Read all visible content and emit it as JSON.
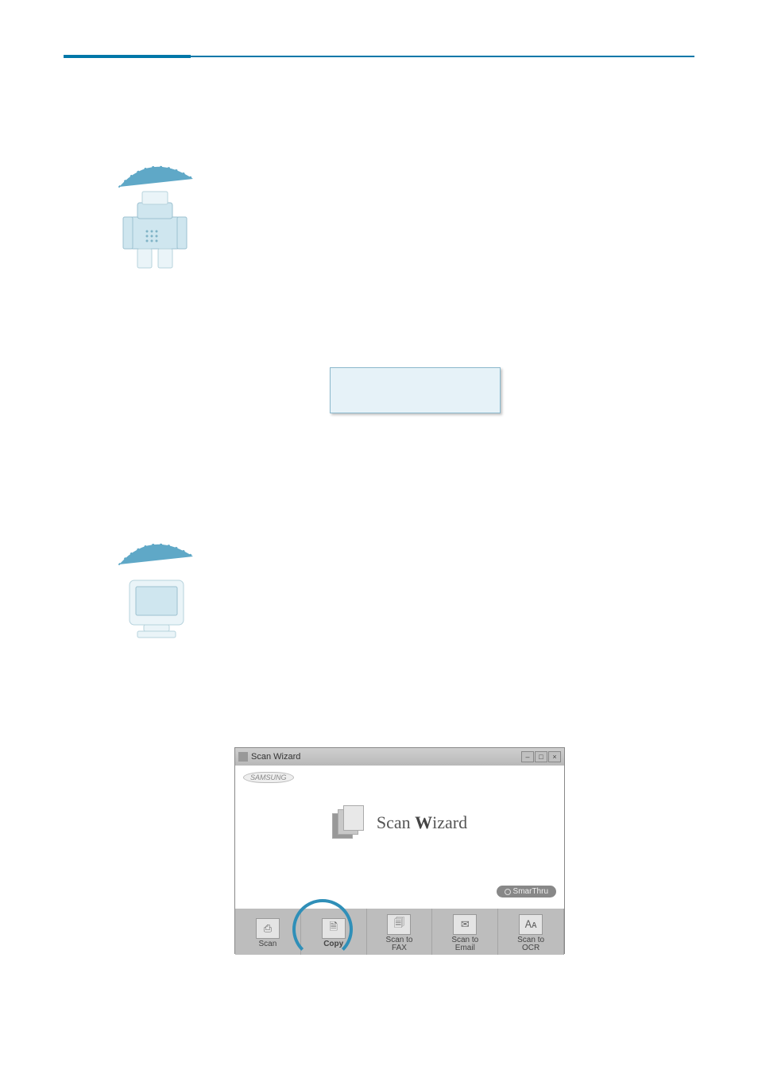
{
  "hr": {},
  "lcd": {},
  "wizard": {
    "titlebar": "Scan Wizard",
    "logo": "SAMSUNG",
    "heading_prefix": "Scan ",
    "heading_bold": "W",
    "heading_suffix": "izard",
    "badge": "SmarThru",
    "tabs": {
      "scan": {
        "label": "Scan",
        "glyph": "⎙"
      },
      "copy": {
        "label": "Copy",
        "glyph": "🗎"
      },
      "fax": {
        "label_line1": "Scan to",
        "label_line2": "FAX",
        "glyph": "🗐"
      },
      "email": {
        "label_line1": "Scan to",
        "label_line2": "Email",
        "glyph": "✉"
      },
      "ocr": {
        "label_line1": "Scan to",
        "label_line2": "OCR",
        "glyph": "🗛"
      }
    },
    "win_buttons": {
      "min": "–",
      "max": "□",
      "close": "×"
    }
  }
}
